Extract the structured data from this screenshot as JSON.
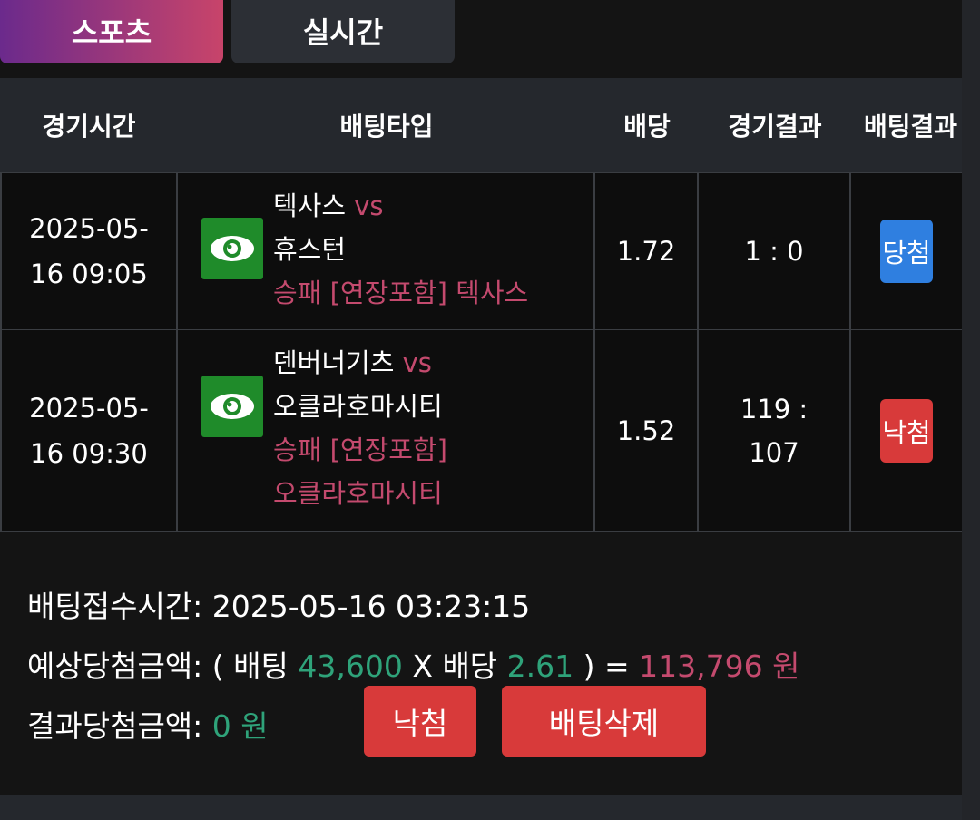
{
  "tabs": [
    {
      "label": "스포츠"
    },
    {
      "label": "실시간"
    }
  ],
  "table": {
    "headers": [
      "경기시간",
      "배팅타입",
      "배당",
      "경기결과",
      "배팅결과"
    ],
    "rows": [
      {
        "time_line1": "2025-05-",
        "time_line2": "16 09:05",
        "icon": "eye-icon",
        "home": "텍사스",
        "vs": "vs",
        "away": "휴스턴",
        "pick_line1": "승패 [연장포함] 텍사스",
        "pick_line2": "",
        "odds": "1.72",
        "score_line1": "1 : 0",
        "score_line2": "",
        "bet_result": "당첨",
        "bet_result_color": "#2f7fe0"
      },
      {
        "time_line1": "2025-05-",
        "time_line2": "16 09:30",
        "icon": "eye-icon",
        "home": "덴버너기츠",
        "vs": "vs",
        "away": "오클라호마시티",
        "pick_line1": "승패 [연장포함]",
        "pick_line2": "오클라호마시티",
        "odds": "1.52",
        "score_line1": "119 :",
        "score_line2": "107",
        "bet_result": "낙첨",
        "bet_result_color": "#d83a3a"
      }
    ]
  },
  "summary": {
    "bet_time_label": "배팅접수시간:",
    "bet_time_value": "2025-05-16 03:23:15",
    "expected_label": "예상당첨금액:",
    "expected_open": "( 배팅",
    "bet_amount": "43,600",
    "times": "X 배당",
    "total_odds": "2.61",
    "expected_close": ") =",
    "expected_amount": "113,796 원",
    "result_label": "결과당첨금액:",
    "result_amount": "0 원"
  },
  "buttons": {
    "lose_label": "낙첨",
    "delete_label": "배팅삭제"
  },
  "colors": {
    "green": "#2fa37a",
    "pink": "#c44a6e",
    "win_blue": "#2f7fe0",
    "lose_red": "#d83a3a"
  }
}
